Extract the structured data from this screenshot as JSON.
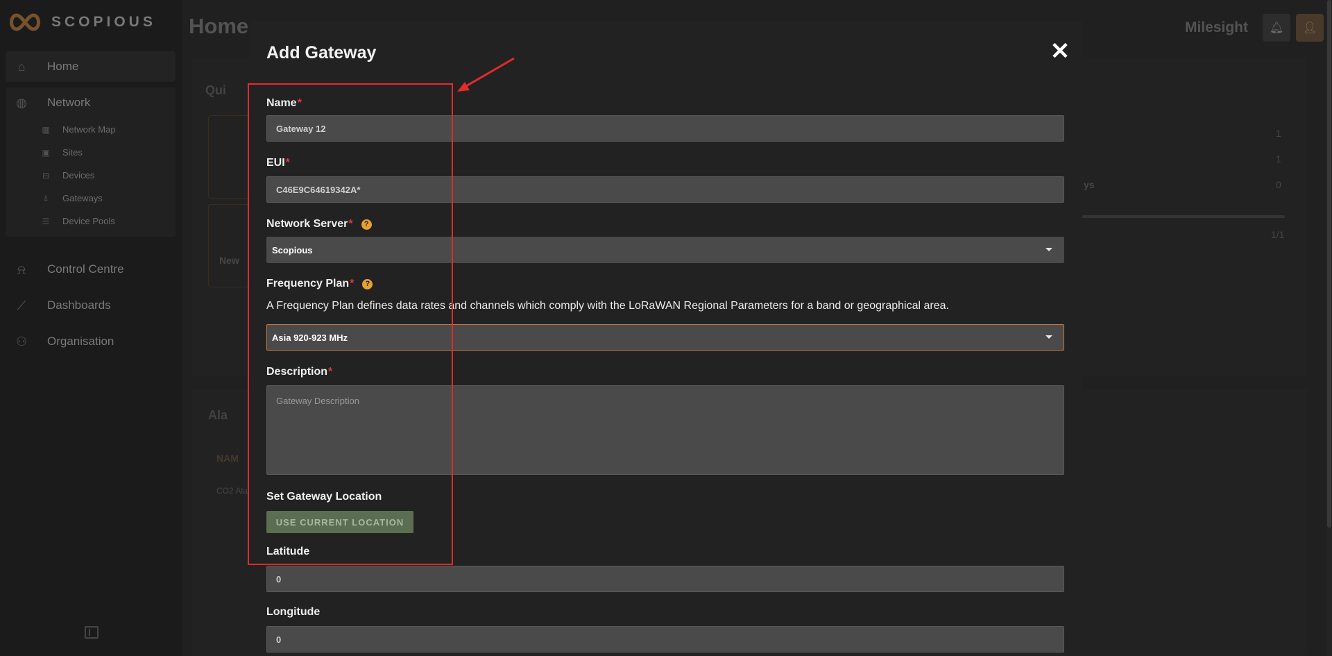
{
  "app": {
    "brand": "SCOPIOUS",
    "page_title": "Home",
    "org_name": "Milesight"
  },
  "sidebar": {
    "items": [
      {
        "label": "Home",
        "icon": "home-icon"
      },
      {
        "label": "Network",
        "icon": "globe-icon"
      },
      {
        "label": "Control Centre",
        "icon": "bell-gear-icon"
      },
      {
        "label": "Dashboards",
        "icon": "chart-line-icon"
      },
      {
        "label": "Organisation",
        "icon": "users-icon"
      }
    ],
    "network_sub": [
      {
        "label": "Network Map",
        "icon": "map-icon"
      },
      {
        "label": "Sites",
        "icon": "building-icon"
      },
      {
        "label": "Devices",
        "icon": "devices-icon"
      },
      {
        "label": "Gateways",
        "icon": "antenna-icon"
      },
      {
        "label": "Device Pools",
        "icon": "list-icon"
      }
    ]
  },
  "background": {
    "quick_title": "Qui",
    "alarm_title": "Ala",
    "new_text": "New",
    "names_header": "NAM",
    "alarm_row": "CO2 Ala",
    "stats": [
      "1",
      "1",
      "0"
    ],
    "stats_label": "ys",
    "pager": "1/1"
  },
  "modal": {
    "title": "Add Gateway",
    "name_label": "Name",
    "name_value": "Gateway 12",
    "eui_label": "EUI",
    "eui_value": "C46E9C64619342A*",
    "network_server_label": "Network Server",
    "network_server_value": "Scopious",
    "frequency_plan_label": "Frequency Plan",
    "frequency_plan_help": "A Frequency Plan defines data rates and channels which comply with the LoRaWAN Regional Parameters for a band or geographical area.",
    "frequency_plan_value": "Asia 920-923 MHz",
    "description_label": "Description",
    "description_placeholder": "Gateway Description",
    "location_label": "Set Gateway Location",
    "location_button": "USE CURRENT LOCATION",
    "latitude_label": "Latitude",
    "latitude_value": "0",
    "longitude_label": "Longitude",
    "longitude_value": "0",
    "required_mark": "*",
    "help_mark": "?"
  },
  "colors": {
    "accent_orange": "#c8793a",
    "required_red": "#e0393e",
    "annotation_red": "#e32b2b",
    "location_button_green": "#5b6e52"
  }
}
